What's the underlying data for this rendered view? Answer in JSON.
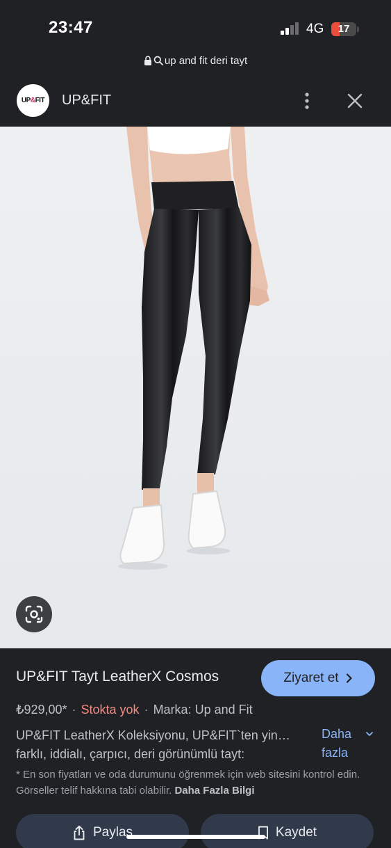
{
  "status_bar": {
    "time": "23:47",
    "network": "4G",
    "battery": "17",
    "battery_color": "#eb4d3d"
  },
  "url_bar": {
    "text": "up and fit deri tayt",
    "icons": [
      "lock-icon",
      "search-icon"
    ]
  },
  "site_header": {
    "logo_text_a": "UP",
    "logo_text_amp": "&",
    "logo_text_b": "FIT",
    "site_name": "UP&FIT",
    "icons": [
      "more-vert-icon",
      "close-icon"
    ]
  },
  "product": {
    "title": "UP&FIT Tayt LeatherX Cosmos",
    "visit_label": "Ziyaret et",
    "price": "₺929,00*",
    "separator": "·",
    "stock": "Stokta yok",
    "brand": "Marka: Up and Fit",
    "description_line1": "UP&FIT LeatherX Koleksiyonu, UP&FIT`ten yin…",
    "description_line2": "farklı, iddialı, çarpıcı, deri görünümlü tayt:",
    "more_label_1": "Daha",
    "more_label_2": "fazla",
    "disclaimer": "* En son fiyatları ve oda durumunu öğrenmek için web sitesini kontrol edin. Görseller telif hakkına tabi olabilir.",
    "disclaimer_link": "Daha Fazla Bilgi"
  },
  "actions": {
    "share_label": "Paylaş",
    "save_label": "Kaydet"
  },
  "colors": {
    "accent": "#8ab4f8",
    "stock_out": "#f28b82",
    "background": "#202124"
  }
}
